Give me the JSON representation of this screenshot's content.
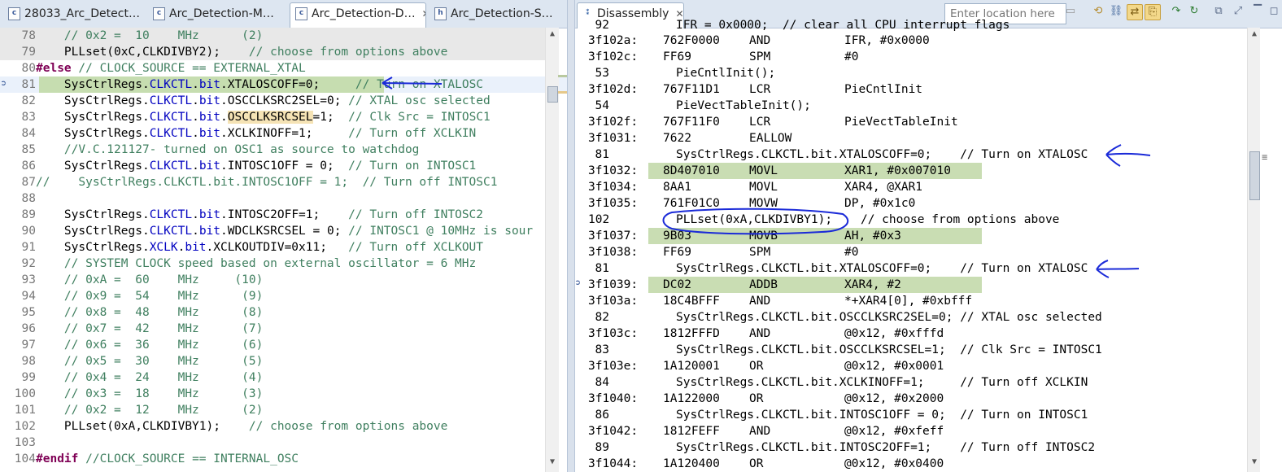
{
  "left_tabs": [
    {
      "label": "28033_Arc_Detect…",
      "icon": "c-source-icon"
    },
    {
      "label": "Arc_Detection-M…",
      "icon": "c-source-icon"
    },
    {
      "label": "Arc_Detection-D…",
      "icon": "c-source-icon",
      "close": "✕"
    },
    {
      "label": "Arc_Detection-S…",
      "icon": "h-header-icon"
    }
  ],
  "right_tab": {
    "label": "Disassembly",
    "close": "✕"
  },
  "location": {
    "placeholder": "Enter location here"
  },
  "source_lines": [
    {
      "n": "78",
      "text": "    // 0x2 =  10    MHz      (2)"
    },
    {
      "n": "79",
      "text": "    PLLset(0xC,CLKDIVBY2);    // choose from options above"
    },
    {
      "n": "80",
      "text": "#else // CLOCK_SOURCE == EXTERNAL_XTAL"
    },
    {
      "n": "81",
      "text": "    SysCtrlRegs.CLKCTL.bit.XTALOSCOFF=0;     // Turn on XTALOSC"
    },
    {
      "n": "82",
      "text": "    SysCtrlRegs.CLKCTL.bit.OSCCLKSRC2SEL=0; // XTAL osc selected"
    },
    {
      "n": "83",
      "text": "    SysCtrlRegs.CLKCTL.bit.OSCCLKSRCSEL=1;  // Clk Src = INTOSC1"
    },
    {
      "n": "84",
      "text": "    SysCtrlRegs.CLKCTL.bit.XCLKINOFF=1;     // Turn off XCLKIN"
    },
    {
      "n": "85",
      "text": "    //V.C.121127- turned on OSC1 as source to watchdog"
    },
    {
      "n": "86",
      "text": "    SysCtrlRegs.CLKCTL.bit.INTOSC1OFF = 0;  // Turn on INTOSC1"
    },
    {
      "n": "87",
      "text": "//    SysCtrlRegs.CLKCTL.bit.INTOSC1OFF = 1;  // Turn off INTOSC1"
    },
    {
      "n": "88",
      "text": ""
    },
    {
      "n": "89",
      "text": "    SysCtrlRegs.CLKCTL.bit.INTOSC2OFF=1;    // Turn off INTOSC2"
    },
    {
      "n": "90",
      "text": "    SysCtrlRegs.CLKCTL.bit.WDCLKSRCSEL = 0; // INTOSC1 @ 10MHz is sour"
    },
    {
      "n": "91",
      "text": "    SysCtrlRegs.XCLK.bit.XCLKOUTDIV=0x11;   // Turn off XCLKOUT"
    },
    {
      "n": "92",
      "text": "    // SYSTEM CLOCK speed based on external oscillator = 6 MHz"
    },
    {
      "n": "93",
      "text": "    // 0xA =  60    MHz     (10)"
    },
    {
      "n": "94",
      "text": "    // 0x9 =  54    MHz      (9)"
    },
    {
      "n": "95",
      "text": "    // 0x8 =  48    MHz      (8)"
    },
    {
      "n": "96",
      "text": "    // 0x7 =  42    MHz      (7)"
    },
    {
      "n": "97",
      "text": "    // 0x6 =  36    MHz      (6)"
    },
    {
      "n": "98",
      "text": "    // 0x5 =  30    MHz      (5)"
    },
    {
      "n": "99",
      "text": "    // 0x4 =  24    MHz      (4)"
    },
    {
      "n": "100",
      "text": "    // 0x3 =  18    MHz      (3)"
    },
    {
      "n": "101",
      "text": "    // 0x2 =  12    MHz      (2)"
    },
    {
      "n": "102",
      "text": "    PLLset(0xA,CLKDIVBY1);    // choose from options above"
    },
    {
      "n": "103",
      "text": ""
    },
    {
      "n": "104",
      "text": "#endif //CLOCK_SOURCE == INTERNAL_OSC"
    }
  ],
  "disasm_rows": [
    {
      "kind": "asm",
      "addr": "3f102a:",
      "op": "762F0000",
      "mn": "AND",
      "args": "IFR, #0x0000"
    },
    {
      "kind": "asm",
      "addr": "3f102c:",
      "op": "FF69",
      "mn": "SPM",
      "args": "#0"
    },
    {
      "kind": "src",
      "n": "53",
      "text": "PieCntlInit();"
    },
    {
      "kind": "asm",
      "addr": "3f102d:",
      "op": "767F11D1",
      "mn": "LCR",
      "args": "PieCntlInit"
    },
    {
      "kind": "src",
      "n": "54",
      "text": "PieVectTableInit();"
    },
    {
      "kind": "asm",
      "addr": "3f102f:",
      "op": "767F11F0",
      "mn": "LCR",
      "args": "PieVectTableInit"
    },
    {
      "kind": "asm",
      "addr": "3f1031:",
      "op": "7622",
      "mn": "EALLOW",
      "args": ""
    },
    {
      "kind": "src",
      "n": "81",
      "text": "SysCtrlRegs.CLKCTL.bit.XTALOSCOFF=0;    // Turn on XTALOSC"
    },
    {
      "kind": "asm",
      "addr": "3f1032:",
      "op": "8D407010",
      "mn": "MOVL",
      "args": "XAR1, #0x007010",
      "hl": true
    },
    {
      "kind": "asm",
      "addr": "3f1034:",
      "op": "8AA1",
      "mn": "MOVL",
      "args": "XAR4, @XAR1"
    },
    {
      "kind": "asm",
      "addr": "3f1035:",
      "op": "761F01C0",
      "mn": "MOVW",
      "args": "DP, #0x1c0"
    },
    {
      "kind": "src",
      "n": "102",
      "text": "PLLset(0xA,CLKDIVBY1);    // choose from options above"
    },
    {
      "kind": "asm",
      "addr": "3f1037:",
      "op": "9B03",
      "mn": "MOVB",
      "args": "AH, #0x3",
      "hl": true
    },
    {
      "kind": "asm",
      "addr": "3f1038:",
      "op": "FF69",
      "mn": "SPM",
      "args": "#0"
    },
    {
      "kind": "src",
      "n": "81",
      "text": "SysCtrlRegs.CLKCTL.bit.XTALOSCOFF=0;    // Turn on XTALOSC"
    },
    {
      "kind": "asm",
      "addr": "3f1039:",
      "op": "DC02",
      "mn": "ADDB",
      "args": "XAR4, #2",
      "hl": true
    },
    {
      "kind": "asm",
      "addr": "3f103a:",
      "op": "18C4BFFF",
      "mn": "AND",
      "args": "*+XAR4[0], #0xbfff"
    },
    {
      "kind": "src",
      "n": "82",
      "text": "SysCtrlRegs.CLKCTL.bit.OSCCLKSRC2SEL=0; // XTAL osc selected"
    },
    {
      "kind": "asm",
      "addr": "3f103c:",
      "op": "1812FFFD",
      "mn": "AND",
      "args": "@0x12, #0xfffd"
    },
    {
      "kind": "src",
      "n": "83",
      "text": "SysCtrlRegs.CLKCTL.bit.OSCCLKSRCSEL=1;  // Clk Src = INTOSC1"
    },
    {
      "kind": "asm",
      "addr": "3f103e:",
      "op": "1A120001",
      "mn": "OR",
      "args": "@0x12, #0x0001"
    },
    {
      "kind": "src",
      "n": "84",
      "text": "SysCtrlRegs.CLKCTL.bit.XCLKINOFF=1;     // Turn off XCLKIN"
    },
    {
      "kind": "asm",
      "addr": "3f1040:",
      "op": "1A122000",
      "mn": "OR",
      "args": "@0x12, #0x2000"
    },
    {
      "kind": "src",
      "n": "86",
      "text": "SysCtrlRegs.CLKCTL.bit.INTOSC1OFF = 0;  // Turn on INTOSC1"
    },
    {
      "kind": "asm",
      "addr": "3f1042:",
      "op": "1812FEFF",
      "mn": "AND",
      "args": "@0x12, #0xfeff"
    },
    {
      "kind": "src",
      "n": "89",
      "text": "SysCtrlRegs.CLKCTL.bit.INTOSC2OFF=1;    // Turn off INTOSC2"
    },
    {
      "kind": "asm",
      "addr": "3f1044:",
      "op": "1A120400",
      "mn": "OR",
      "args": "@0x12, #0x0400"
    }
  ],
  "top_partial": {
    "addr": "92",
    "text": "IFR = 0x0000;  // clear all CPU interrupt flags"
  },
  "colors": {
    "comment": "#3f7f5f",
    "field": "#0000c0",
    "keyword": "#7f0055",
    "current_line": "#c6ddb0",
    "ink": "#1a2ad8"
  }
}
